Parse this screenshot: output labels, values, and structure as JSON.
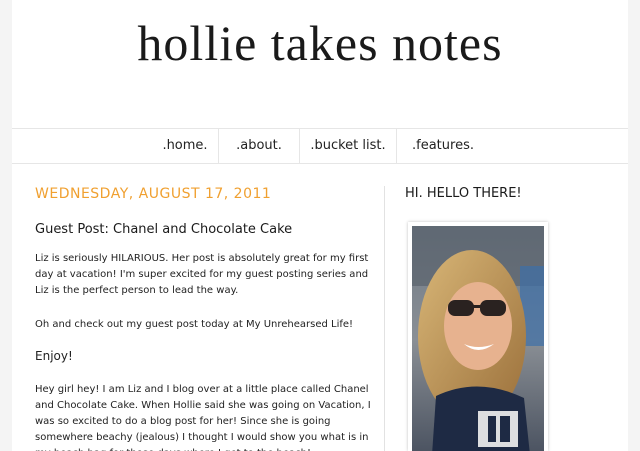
{
  "blog": {
    "title": "hollie takes notes"
  },
  "nav": {
    "items": [
      {
        "label": ".home."
      },
      {
        "label": ".about."
      },
      {
        "label": ".bucket list."
      },
      {
        "label": ".features."
      }
    ]
  },
  "post": {
    "date": "WEDNESDAY, AUGUST 17, 2011",
    "title": "Guest Post: Chanel and Chocolate Cake",
    "paragraphs": [
      "Liz is seriously HILARIOUS. Her post is absolutely great for my first day at vacation! I'm super excited for my guest posting series and Liz is the perfect person to lead the way.",
      "Oh and check out my guest post today at My Unrehearsed Life!",
      "Enjoy!",
      "Hey girl hey! I am Liz and I blog over at a little place called Chanel and Chocolate Cake. When Hollie said she was going on Vacation, I was so excited to do a blog post for her! Since she is going somewhere beachy (jealous) I thought I would show you what is in my beach bag for those days where I get to the beach!"
    ]
  },
  "sidebar": {
    "heading": "HI. HELLO THERE!"
  },
  "colors": {
    "accent": "#f0a030"
  }
}
